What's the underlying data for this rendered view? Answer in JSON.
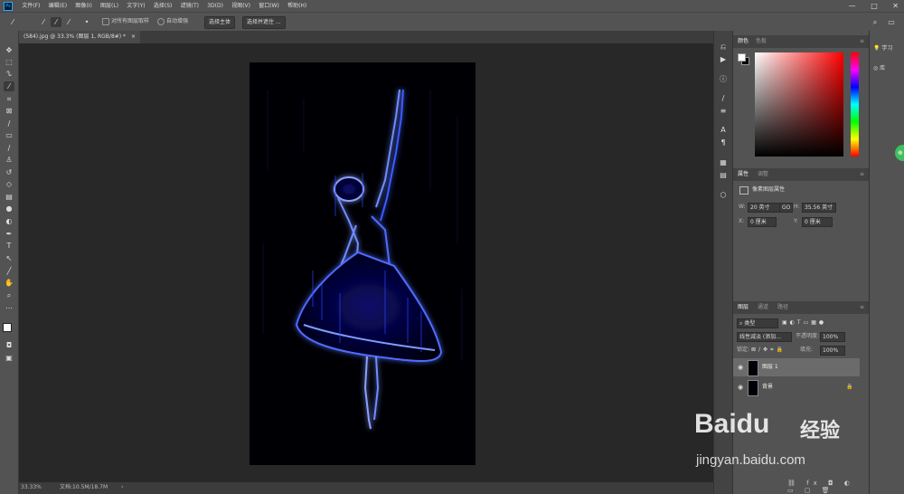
{
  "app": {
    "logo": "Ps"
  },
  "menu": [
    "文件(F)",
    "编辑(E)",
    "图像(I)",
    "图层(L)",
    "文字(Y)",
    "选择(S)",
    "滤镜(T)",
    "3D(D)",
    "视图(V)",
    "窗口(W)",
    "帮助(H)"
  ],
  "window_controls": {
    "minimize": "—",
    "maximize": "□",
    "close": "✕"
  },
  "options": {
    "sample_all_layers": "对所有图层取样",
    "auto_enhance": "自动增强",
    "select_subject": "选择主体",
    "select_and_mask": "选择并遮住 ..."
  },
  "document": {
    "tab_title": "(584).jpg @ 33.3% (图层 1, RGB/8#) *",
    "close": "×"
  },
  "status": {
    "zoom": "33.33%",
    "doc_info": "文档:10.5M/18.7M",
    "arrow": "›"
  },
  "color_panel": {
    "tabs": [
      "颜色",
      "色板"
    ],
    "fg_color": "#ffffff",
    "bg_color": "#000000",
    "hue_color": "#ff0000"
  },
  "properties_panel": {
    "tabs": [
      "属性",
      "调整"
    ],
    "header": "像素图层属性",
    "w_label": "W:",
    "w_value": "20 英寸",
    "link": "GO",
    "h_label": "H:",
    "h_value": "35.56 英寸",
    "x_label": "X:",
    "x_value": "0 厘米",
    "y_label": "Y:",
    "y_value": "0 厘米"
  },
  "layers_panel": {
    "tabs": [
      "图层",
      "通道",
      "路径"
    ],
    "filter_kind": "类型",
    "blend_mode": "线性减淡 (添加...",
    "opacity_label": "不透明度:",
    "opacity_value": "100%",
    "lock_label": "锁定:",
    "fill_label": "填充:",
    "fill_value": "100%",
    "layers": [
      {
        "name": "图层 1",
        "selected": true
      },
      {
        "name": "背景",
        "locked": true
      }
    ]
  },
  "learn_panel": {
    "learn": "学习",
    "library": "库"
  },
  "watermark": {
    "brand": "Baidu",
    "cn": "经验",
    "url": "jingyan.baidu.com"
  }
}
